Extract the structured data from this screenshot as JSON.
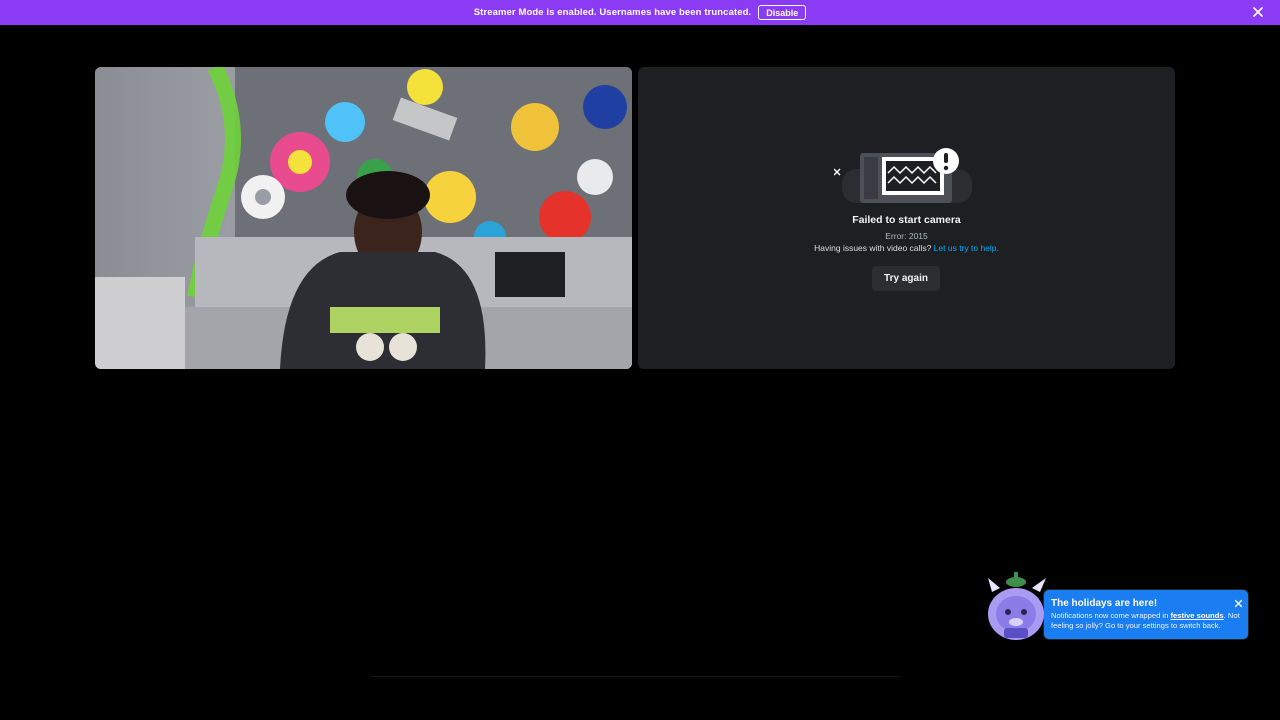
{
  "banner": {
    "message": "Streamer Mode is enabled. Usernames have been truncated.",
    "disable_label": "Disable",
    "close_icon": "close-icon",
    "color": "#8c3bf5"
  },
  "tiles": {
    "video": {
      "description_icon": "participant-video"
    },
    "camera": {
      "icon": "camera-error-illustration",
      "title": "Failed to start camera",
      "error": "Error: 2015",
      "help_prefix": "Having issues with video calls?",
      "help_link": "Let us try to help.",
      "retry_label": "Try again"
    }
  },
  "holiday": {
    "title": "The holidays are here!",
    "body_prefix": "Notifications now come wrapped in",
    "body_link": "festive sounds",
    "body_suffix": ". Not feeling so jolly? Go to your settings to switch back.",
    "mascot_icon": "holiday-mascot-icon",
    "close_icon": "close-icon",
    "color": "#1a7ef2"
  }
}
